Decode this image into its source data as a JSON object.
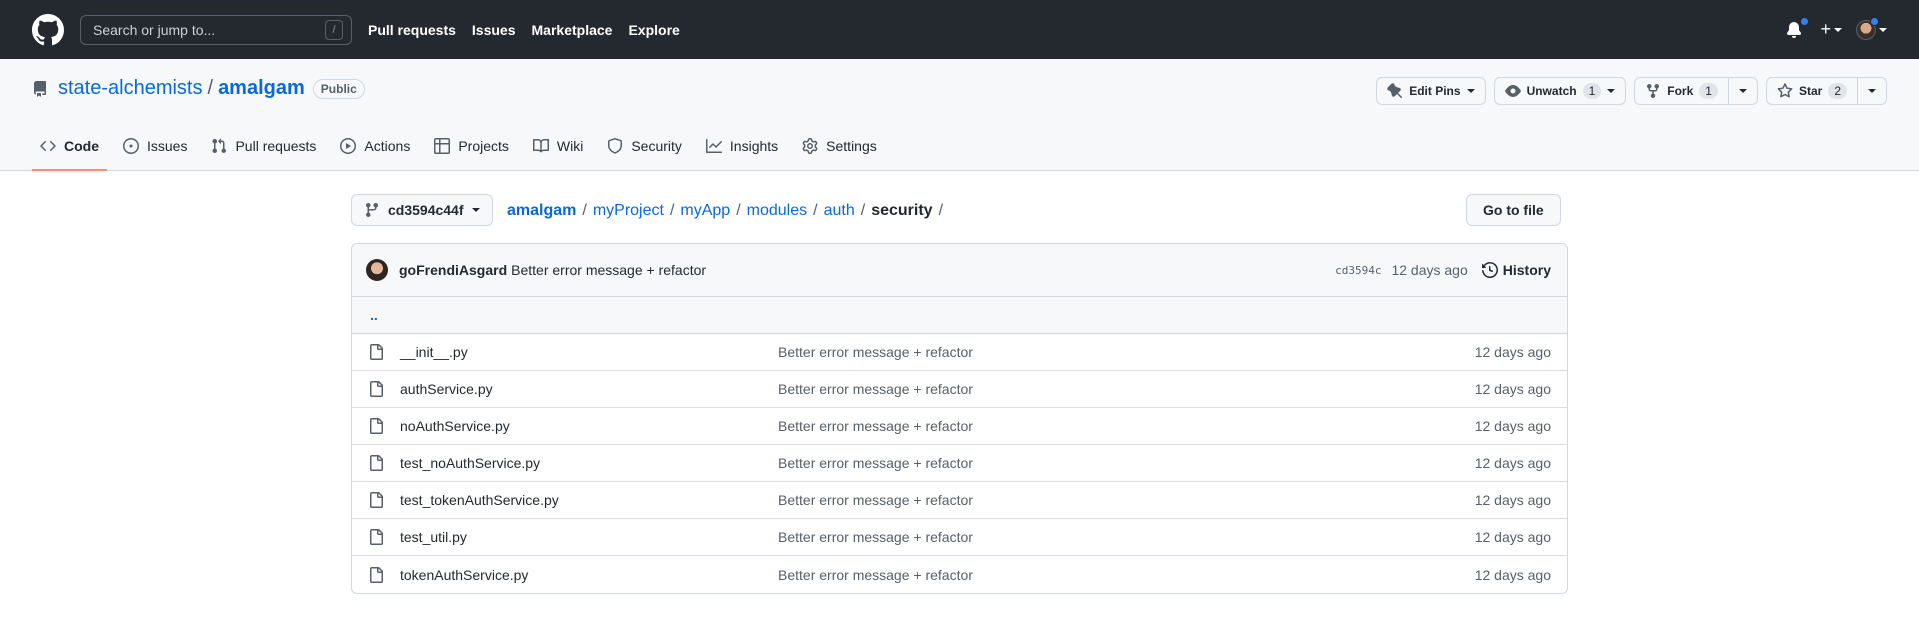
{
  "header": {
    "search_placeholder": "Search or jump to...",
    "search_shortcut": "/",
    "nav": [
      "Pull requests",
      "Issues",
      "Marketplace",
      "Explore"
    ],
    "plus_symbol": "+"
  },
  "repo": {
    "owner": "state-alchemists",
    "separator": "/",
    "name": "amalgam",
    "visibility": "Public",
    "actions": {
      "edit_pins": "Edit Pins",
      "unwatch": "Unwatch",
      "unwatch_count": "1",
      "fork": "Fork",
      "fork_count": "1",
      "star": "Star",
      "star_count": "2"
    },
    "tabs": [
      {
        "label": "Code",
        "icon": "code-icon",
        "selected": true
      },
      {
        "label": "Issues",
        "icon": "issue-opened-icon"
      },
      {
        "label": "Pull requests",
        "icon": "git-pull-request-icon"
      },
      {
        "label": "Actions",
        "icon": "play-icon"
      },
      {
        "label": "Projects",
        "icon": "table-icon"
      },
      {
        "label": "Wiki",
        "icon": "book-icon"
      },
      {
        "label": "Security",
        "icon": "shield-icon"
      },
      {
        "label": "Insights",
        "icon": "graph-icon"
      },
      {
        "label": "Settings",
        "icon": "gear-icon"
      }
    ]
  },
  "path": {
    "branch": "cd3594c44f",
    "crumbs": [
      "amalgam",
      "myProject",
      "myApp",
      "modules",
      "auth"
    ],
    "current": "security",
    "separator": "/",
    "goto_file": "Go to file"
  },
  "commit": {
    "author": "goFrendiAsgard",
    "message": "Better error message + refactor",
    "sha": "cd3594c",
    "age": "12 days ago",
    "history": "History"
  },
  "up_dir": "..",
  "files": [
    {
      "name": "__init__.py",
      "message": "Better error message + refactor",
      "age": "12 days ago"
    },
    {
      "name": "authService.py",
      "message": "Better error message + refactor",
      "age": "12 days ago"
    },
    {
      "name": "noAuthService.py",
      "message": "Better error message + refactor",
      "age": "12 days ago"
    },
    {
      "name": "test_noAuthService.py",
      "message": "Better error message + refactor",
      "age": "12 days ago"
    },
    {
      "name": "test_tokenAuthService.py",
      "message": "Better error message + refactor",
      "age": "12 days ago"
    },
    {
      "name": "test_util.py",
      "message": "Better error message + refactor",
      "age": "12 days ago"
    },
    {
      "name": "tokenAuthService.py",
      "message": "Better error message + refactor",
      "age": "12 days ago"
    }
  ],
  "colors": {
    "header_bg": "#24292f",
    "link": "#0969da",
    "tab_underline": "#fd8c73",
    "notification_dot": "#2f81f7"
  }
}
